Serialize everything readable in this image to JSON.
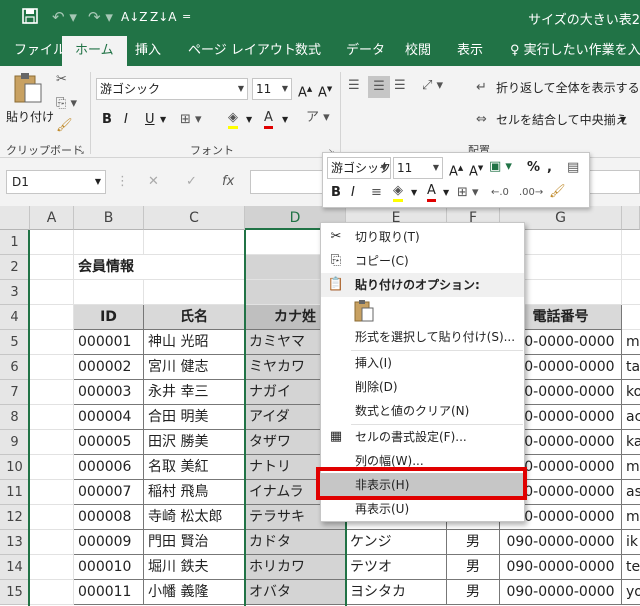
{
  "titlebar": {
    "title": "サイズの大きい表2",
    "save_icon": "save-icon",
    "undo_icon": "undo-icon",
    "redo_icon": "redo-icon",
    "sort_asc": "A↓Z",
    "sort_desc": "Z↓A",
    "qat_more": "="
  },
  "tabs": [
    "ファイル",
    "ホーム",
    "挿入",
    "ページ レイアウト",
    "数式",
    "データ",
    "校閲",
    "表示"
  ],
  "tell_me": "実行したい作業を入力",
  "ribbon": {
    "clipboard": {
      "paste_label": "貼り付け",
      "group_label": "クリップボード"
    },
    "font": {
      "font_name": "游ゴシック",
      "font_size": "11",
      "bold": "B",
      "italic": "I",
      "underline": "U",
      "group_label": "フォント"
    },
    "alignment": {
      "wrap_text": "折り返して全体を表示する",
      "merge_center": "セルを結合して中央揃え",
      "group_label": "配置"
    }
  },
  "formula_bar": {
    "name_box": "D1",
    "fx": "fx",
    "formula": ""
  },
  "columns": [
    "A",
    "B",
    "C",
    "D",
    "E",
    "F",
    "G"
  ],
  "rows": [
    "1",
    "2",
    "3",
    "4",
    "5",
    "6",
    "7",
    "8",
    "9",
    "10",
    "11",
    "12",
    "13",
    "14",
    "15"
  ],
  "sheet": {
    "title": "会員情報",
    "headers": {
      "id": "ID",
      "name": "氏名",
      "kana_sei": "カナ姓",
      "phone": "電話番号"
    },
    "records": [
      {
        "id": "000001",
        "name": "神山 光昭",
        "kana_sei": "カミヤマ",
        "kana_mei": "",
        "gender": "",
        "phone": "090-0000-0000",
        "email": "m"
      },
      {
        "id": "000002",
        "name": "宮川 健志",
        "kana_sei": "ミヤカワ",
        "kana_mei": "",
        "gender": "",
        "phone": "090-0000-0000",
        "email": "ta"
      },
      {
        "id": "000003",
        "name": "永井 幸三",
        "kana_sei": "ナガイ",
        "kana_mei": "",
        "gender": "",
        "phone": "090-0000-0000",
        "email": "ko"
      },
      {
        "id": "000004",
        "name": "合田 明美",
        "kana_sei": "アイダ",
        "kana_mei": "",
        "gender": "",
        "phone": "090-0000-0000",
        "email": "ac"
      },
      {
        "id": "000005",
        "name": "田沢 勝美",
        "kana_sei": "タザワ",
        "kana_mei": "",
        "gender": "",
        "phone": "090-0000-0000",
        "email": "ka"
      },
      {
        "id": "000006",
        "name": "名取 美紅",
        "kana_sei": "ナトリ",
        "kana_mei": "",
        "gender": "",
        "phone": "090-0000-0000",
        "email": "m"
      },
      {
        "id": "000007",
        "name": "稲村 飛鳥",
        "kana_sei": "イナムラ",
        "kana_mei": "",
        "gender": "",
        "phone": "090-0000-0000",
        "email": "as"
      },
      {
        "id": "000008",
        "name": "寺崎 松太郎",
        "kana_sei": "テラサキ",
        "kana_mei": "",
        "gender": "",
        "phone": "090-0000-0000",
        "email": "m"
      },
      {
        "id": "000009",
        "name": "門田 賢治",
        "kana_sei": "カドタ",
        "kana_mei": "ケンジ",
        "gender": "男",
        "phone": "090-0000-0000",
        "email": "ik"
      },
      {
        "id": "000010",
        "name": "堀川 鉄夫",
        "kana_sei": "ホリカワ",
        "kana_mei": "テツオ",
        "gender": "男",
        "phone": "090-0000-0000",
        "email": "te"
      },
      {
        "id": "000011",
        "name": "小幡 義隆",
        "kana_sei": "オバタ",
        "kana_mei": "ヨシタカ",
        "gender": "男",
        "phone": "090-0000-0000",
        "email": "yo"
      }
    ]
  },
  "mini_toolbar": {
    "font_name": "游ゴシック",
    "font_size": "11",
    "grow": "A^",
    "shrink": "Aˇ",
    "percent": "%",
    "comma": ",",
    "bold": "B",
    "italic": "I"
  },
  "context_menu": {
    "cut": "切り取り(T)",
    "copy": "コピー(C)",
    "paste_options": "貼り付けのオプション:",
    "paste_special": "形式を選択して貼り付け(S)...",
    "insert": "挿入(I)",
    "delete": "削除(D)",
    "clear": "数式と値のクリア(N)",
    "format_cells": "セルの書式設定(F)...",
    "col_width": "列の幅(W)...",
    "hide": "非表示(H)",
    "unhide": "再表示(U)"
  },
  "colors": {
    "excel_green": "#217346",
    "highlight_red": "#e00000",
    "selection_gray": "#d4d4d4"
  }
}
